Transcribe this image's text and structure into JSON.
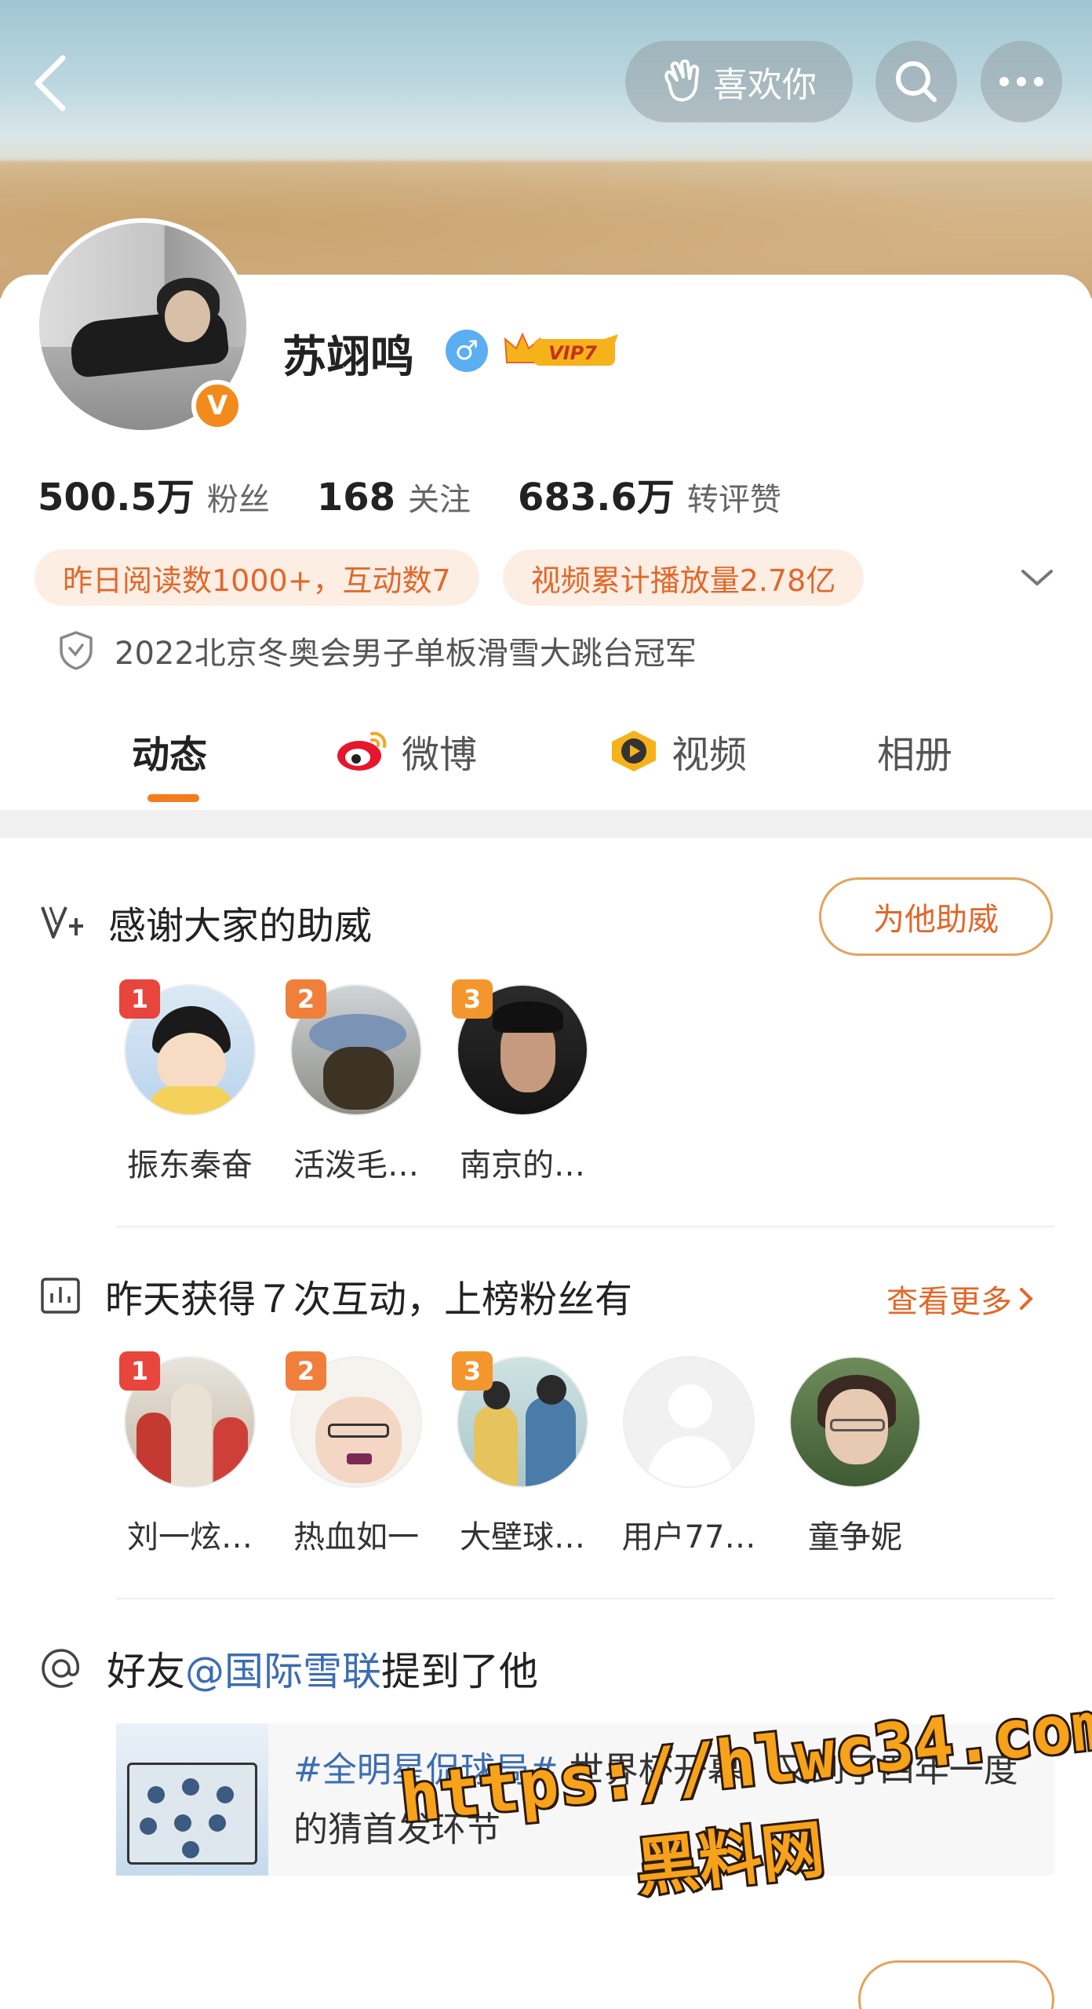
{
  "header": {
    "like_label": "喜欢你"
  },
  "profile": {
    "name": "苏翊鸣",
    "vip_label": "VIP7",
    "verified_mark": "V",
    "gender_symbol": "♂",
    "stats": [
      {
        "num": "500.5万",
        "label": "粉丝"
      },
      {
        "num": "168",
        "label": "关注"
      },
      {
        "num": "683.6万",
        "label": "转评赞"
      }
    ],
    "tags": [
      "昨日阅读数1000+，互动数7",
      "视频累计播放量2.78亿"
    ],
    "honor": "2022北京冬奥会男子单板滑雪大跳台冠军"
  },
  "tabs": [
    {
      "label": "动态",
      "active": true
    },
    {
      "label": "微博",
      "active": false
    },
    {
      "label": "视频",
      "active": false
    },
    {
      "label": "相册",
      "active": false
    }
  ],
  "support_section": {
    "title": "感谢大家的助威",
    "button_label": "为他助威",
    "fans": [
      {
        "rank": "1",
        "name": "振东秦奋"
      },
      {
        "rank": "2",
        "name": "活泼毛…"
      },
      {
        "rank": "3",
        "name": "南京的…"
      }
    ]
  },
  "interaction_section": {
    "title": "昨天获得７次互动，上榜粉丝有",
    "more_label": "查看更多",
    "fans": [
      {
        "rank": "1",
        "name": "刘一炫…"
      },
      {
        "rank": "2",
        "name": "热血如一"
      },
      {
        "rank": "3",
        "name": "大壁球…"
      },
      {
        "rank": "",
        "name": "用户77…"
      },
      {
        "rank": "",
        "name": "童争妮"
      }
    ]
  },
  "mention_section": {
    "prefix": "好友",
    "link": "@国际雪联",
    "suffix": "提到了他",
    "post": {
      "hashtag": "#全明星侃球局#",
      "text": " 世界杯开幕，又到了四年一度的猜首发环节"
    }
  },
  "watermark": {
    "line1": "https://hlwc34.com",
    "line2": "黑料网"
  },
  "colors": {
    "accent": "#f27d1e",
    "tag_bg": "#fdeee4",
    "link": "#3b6db3",
    "rank1": "#e8453c",
    "rank2": "#f07f3c",
    "rank3": "#f3962e"
  }
}
